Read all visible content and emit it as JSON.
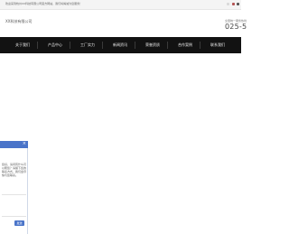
{
  "topbar": {
    "notice": "欢迎来到杭州XX科技有限公司官方网站，我们将竭诚为您服务！",
    "icons": [
      "wechat-icon",
      "weibo-icon",
      "user-icon"
    ]
  },
  "header": {
    "company_name": "XX科技有限公司",
    "hotline_label": "全国统一服务热线",
    "phone": "025-5"
  },
  "nav": {
    "items": [
      {
        "label": "关于我们"
      },
      {
        "label": "产品中心"
      },
      {
        "label": "工厂实力"
      },
      {
        "label": "新闻资讯"
      },
      {
        "label": "荣誉资质"
      },
      {
        "label": "合作案例"
      },
      {
        "label": "联系我们"
      }
    ]
  },
  "chat": {
    "close_glyph": "×",
    "message": "您好，请问有什么可以帮您？请留下您的联系方式，我们会尽快与您联系。",
    "input_placeholder": "",
    "send_label": "发送"
  },
  "colors": {
    "nav_bg": "#121212",
    "chat_accent": "#4a74c9"
  }
}
